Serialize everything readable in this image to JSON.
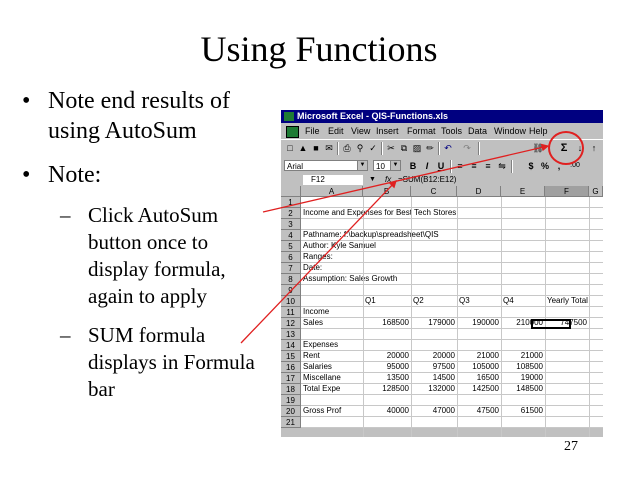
{
  "slide": {
    "title": "Using Functions",
    "page_number": "27",
    "bullets": [
      {
        "marker": "•",
        "text": "Note end results of using AutoSum"
      },
      {
        "marker": "•",
        "text": "Note:"
      }
    ],
    "subbullets": [
      {
        "marker": "–",
        "text": "Click AutoSum button once to display formula, again to apply"
      },
      {
        "marker": "–",
        "text": "SUM formula displays in Formula bar"
      }
    ]
  },
  "excel": {
    "window_title": "Microsoft Excel - QIS-Functions.xls",
    "menu": [
      "File",
      "Edit",
      "View",
      "Insert",
      "Format",
      "Tools",
      "Data",
      "Window",
      "Help"
    ],
    "font_name": "Arial",
    "font_size": "10",
    "name_box": "F12",
    "fx_label": "fx",
    "formula": "=SUM(B12:E12)",
    "columns": [
      "A",
      "B",
      "C",
      "D",
      "E",
      "F",
      "G"
    ],
    "rows": [
      {
        "n": "1",
        "a": "",
        "b": "",
        "c": "",
        "d": "",
        "e": "",
        "f": ""
      },
      {
        "n": "2",
        "a": "Income and Expenses for Best Tech Stores",
        "b": "",
        "c": "",
        "d": "",
        "e": "",
        "f": ""
      },
      {
        "n": "3",
        "a": "",
        "b": "",
        "c": "",
        "d": "",
        "e": "",
        "f": ""
      },
      {
        "n": "4",
        "a": "Pathname: f:\\backup\\spreadsheet\\QIS",
        "b": "",
        "c": "",
        "d": "",
        "e": "",
        "f": ""
      },
      {
        "n": "5",
        "a": "Author: Kyle Samuel",
        "b": "",
        "c": "",
        "d": "",
        "e": "",
        "f": ""
      },
      {
        "n": "6",
        "a": "Ranges:",
        "b": "",
        "c": "",
        "d": "",
        "e": "",
        "f": ""
      },
      {
        "n": "7",
        "a": "Date:",
        "b": "",
        "c": "",
        "d": "",
        "e": "",
        "f": ""
      },
      {
        "n": "8",
        "a": "Assumption: Sales Growth",
        "b": "",
        "c": "",
        "d": "",
        "e": "",
        "f": ""
      },
      {
        "n": "9",
        "a": "",
        "b": "",
        "c": "",
        "d": "",
        "e": "",
        "f": ""
      },
      {
        "n": "10",
        "a": "",
        "b": "Q1",
        "c": "Q2",
        "d": "Q3",
        "e": "Q4",
        "f": "Yearly Total"
      },
      {
        "n": "11",
        "a": "Income",
        "b": "",
        "c": "",
        "d": "",
        "e": "",
        "f": ""
      },
      {
        "n": "12",
        "a": "Sales",
        "b": "168500",
        "c": "179000",
        "d": "190000",
        "e": "210000",
        "f": "747500"
      },
      {
        "n": "13",
        "a": "",
        "b": "",
        "c": "",
        "d": "",
        "e": "",
        "f": ""
      },
      {
        "n": "14",
        "a": "Expenses",
        "b": "",
        "c": "",
        "d": "",
        "e": "",
        "f": ""
      },
      {
        "n": "15",
        "a": "Rent",
        "b": "20000",
        "c": "20000",
        "d": "21000",
        "e": "21000",
        "f": ""
      },
      {
        "n": "16",
        "a": "Salaries",
        "b": "95000",
        "c": "97500",
        "d": "105000",
        "e": "108500",
        "f": ""
      },
      {
        "n": "17",
        "a": "Miscellane",
        "b": "13500",
        "c": "14500",
        "d": "16500",
        "e": "19000",
        "f": ""
      },
      {
        "n": "18",
        "a": "Total Expe",
        "b": "128500",
        "c": "132000",
        "d": "142500",
        "e": "148500",
        "f": ""
      },
      {
        "n": "19",
        "a": "",
        "b": "",
        "c": "",
        "d": "",
        "e": "",
        "f": ""
      },
      {
        "n": "20",
        "a": "Gross Prof",
        "b": "40000",
        "c": "47000",
        "d": "47500",
        "e": "61500",
        "f": ""
      },
      {
        "n": "21",
        "a": "",
        "b": "",
        "c": "",
        "d": "",
        "e": "",
        "f": ""
      }
    ],
    "toolbar1_icons": [
      "new-icon",
      "open-icon",
      "save-icon",
      "email-icon",
      "print-icon",
      "print-preview-icon",
      "spelling-icon",
      "cut-icon",
      "copy-icon",
      "paste-icon",
      "format-painter-icon",
      "undo-icon",
      "redo-icon",
      "hyperlink-icon",
      "autosum-icon",
      "sort-ascending-icon",
      "sort-descending-icon"
    ],
    "toolbar2_icons": [
      "bold-icon",
      "italic-icon",
      "underline-icon",
      "align-left-icon",
      "center-icon",
      "align-right-icon",
      "merge-center-icon",
      "currency-icon",
      "percent-icon",
      "comma-icon",
      "increase-decimal-icon"
    ],
    "autosum_symbol": "Σ",
    "currency_symbol": "$",
    "percent_symbol": "%",
    "comma_symbol": ",",
    "bold_symbol": "B",
    "italic_symbol": "I",
    "underline_symbol": "U",
    "annotation_color": "#e02020"
  }
}
